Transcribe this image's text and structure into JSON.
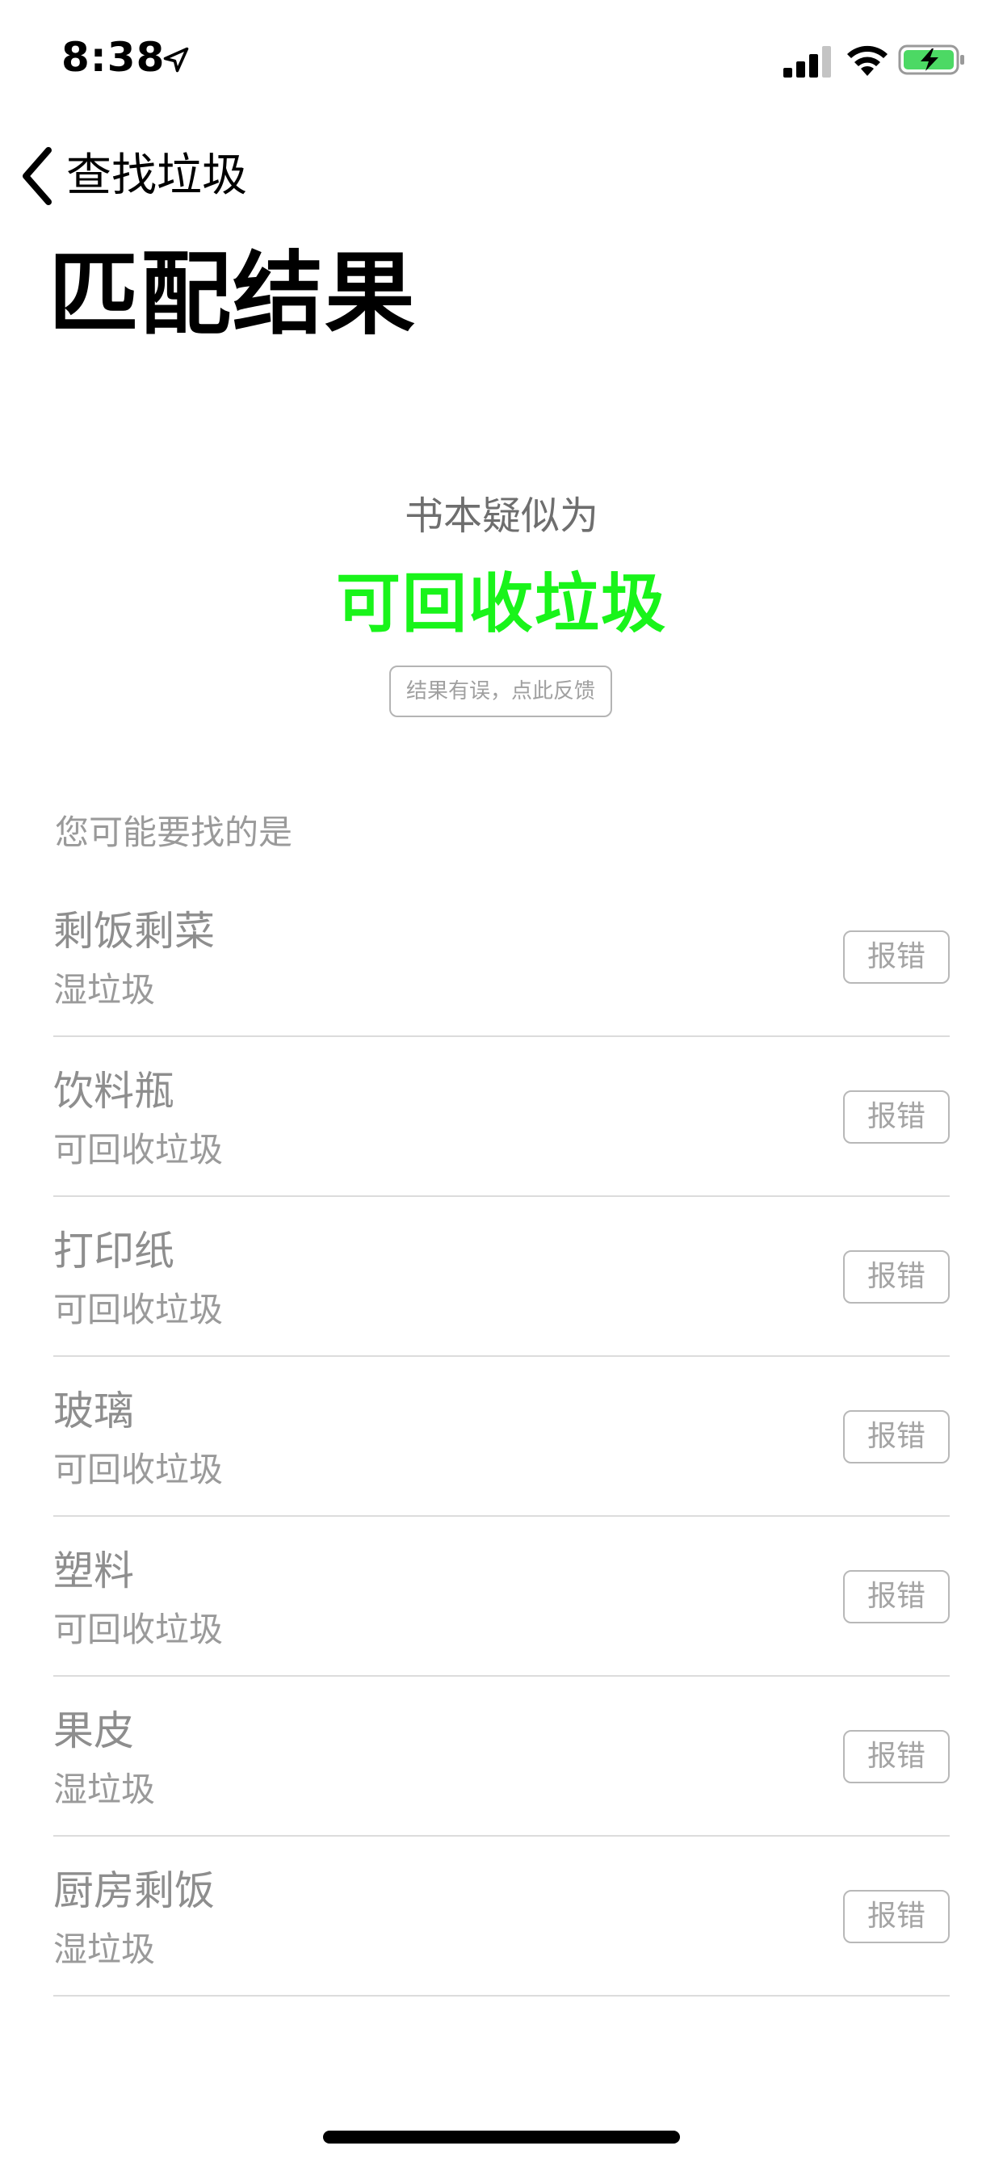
{
  "status_bar": {
    "time": "8:38",
    "location_icon": "location-arrow-icon",
    "signal_icon": "cellular-signal-icon",
    "wifi_icon": "wifi-icon",
    "battery_icon": "battery-charging-icon",
    "battery_color": "#4cd964"
  },
  "nav": {
    "back_icon": "chevron-left-icon",
    "back_label": "查找垃圾"
  },
  "page_title": "匹配结果",
  "result": {
    "subtitle": "书本疑似为",
    "category": "可回收垃圾",
    "category_color": "#19f41a",
    "feedback_label": "结果有误，点此反馈"
  },
  "suggestions": {
    "heading": "您可能要找的是",
    "report_label": "报错",
    "items": [
      {
        "name": "剩饭剩菜",
        "type": "湿垃圾"
      },
      {
        "name": "饮料瓶",
        "type": "可回收垃圾"
      },
      {
        "name": "打印纸",
        "type": "可回收垃圾"
      },
      {
        "name": "玻璃",
        "type": "可回收垃圾"
      },
      {
        "name": "塑料",
        "type": "可回收垃圾"
      },
      {
        "name": "果皮",
        "type": "湿垃圾"
      },
      {
        "name": "厨房剩饭",
        "type": "湿垃圾"
      }
    ]
  }
}
